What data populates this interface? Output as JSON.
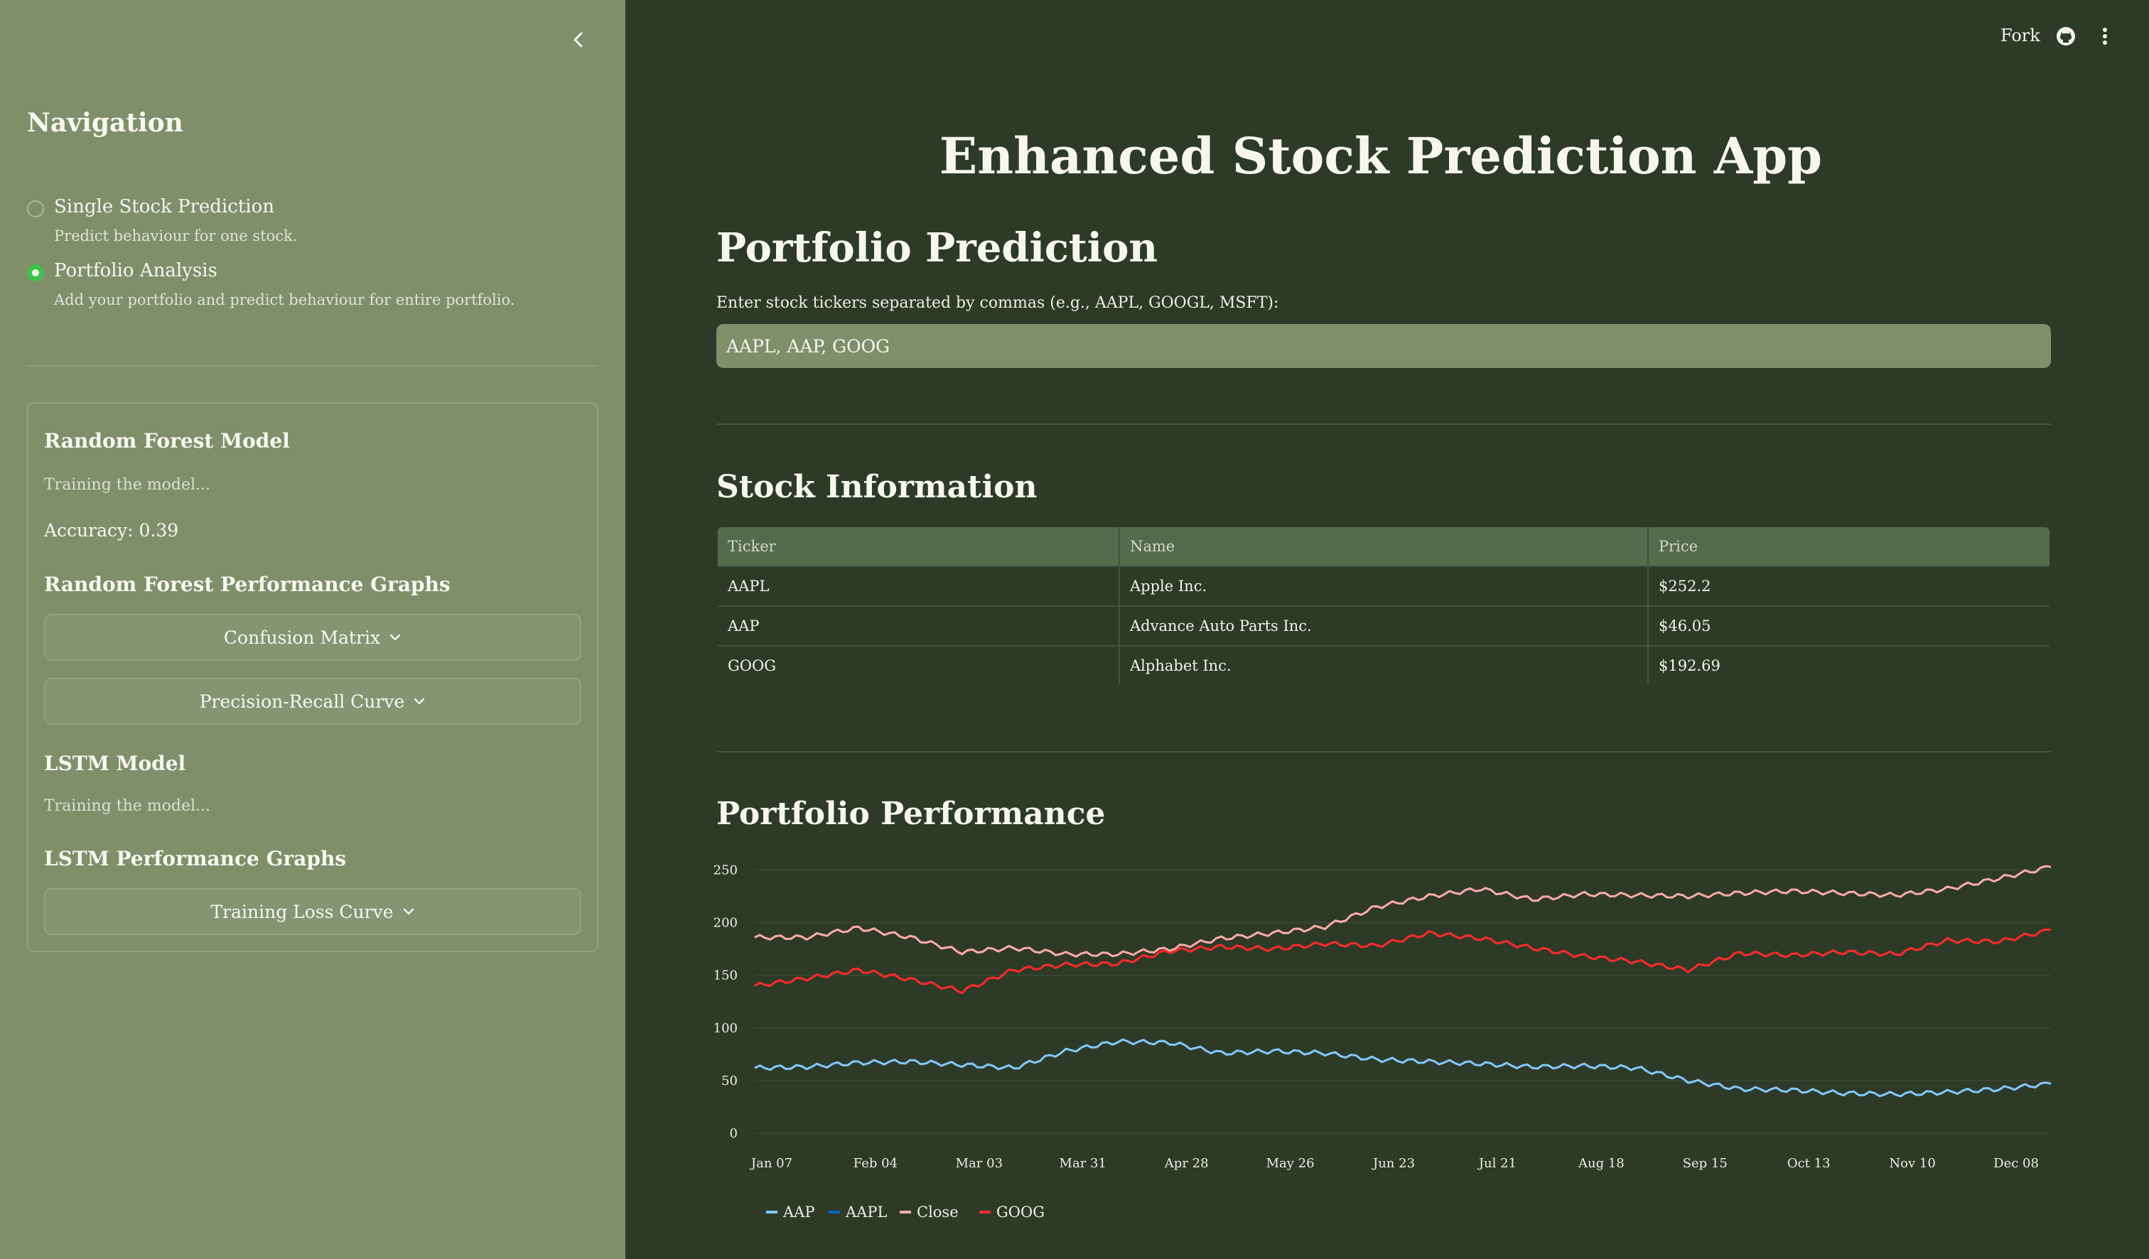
{
  "header": {
    "fork_label": "Fork",
    "icons": [
      "github-icon",
      "more-vertical-icon"
    ]
  },
  "sidebar": {
    "collapse_icon": "chevron-left-icon",
    "nav_title": "Navigation",
    "options": [
      {
        "label": "Single Stock Prediction",
        "caption": "Predict behaviour for one stock.",
        "selected": false
      },
      {
        "label": "Portfolio Analysis",
        "caption": "Add your portfolio and predict behaviour for entire portfolio.",
        "selected": true
      }
    ],
    "rf_title": "Random Forest Model",
    "rf_status": "Training the model...",
    "rf_accuracy": "Accuracy: 0.39",
    "rf_graphs_title": "Random Forest Performance Graphs",
    "confusion_label": "Confusion Matrix",
    "pr_label": "Precision-Recall Curve",
    "lstm_title": "LSTM Model",
    "lstm_status": "Training the model...",
    "lstm_graphs_title": "LSTM Performance Graphs",
    "loss_label": "Training Loss Curve"
  },
  "main": {
    "app_title": "Enhanced Stock Prediction App",
    "portfolio_title": "Portfolio Prediction",
    "ticker_label": "Enter stock tickers separated by commas (e.g., AAPL, GOOGL, MSFT):",
    "ticker_value": "AAPL, AAP, GOOG",
    "stock_info_title": "Stock Information",
    "table": {
      "columns": [
        "Ticker",
        "Name",
        "Price"
      ],
      "rows": [
        [
          "AAPL",
          "Apple Inc.",
          "$252.2"
        ],
        [
          "AAP",
          "Advance Auto Parts Inc.",
          "$46.05"
        ],
        [
          "GOOG",
          "Alphabet Inc.",
          "$192.69"
        ]
      ]
    },
    "performance_title": "Portfolio Performance"
  },
  "colors": {
    "sidebar_bg": "#7f8f6a",
    "main_bg": "#2e3a28",
    "radio_selected": "#40c24a",
    "aap": "#83c9ff",
    "aapl": "#0068c9",
    "close": "#ffabab",
    "goog": "#ff2b2b"
  },
  "chart_data": {
    "type": "line",
    "x": [
      "Jan 07",
      "Jan 21",
      "Feb 04",
      "Feb 18",
      "Mar 03",
      "Mar 17",
      "Mar 31",
      "Apr 14",
      "Apr 28",
      "May 12",
      "May 26",
      "Jun 09",
      "Jun 23",
      "Jul 07",
      "Jul 21",
      "Aug 04",
      "Aug 18",
      "Sep 01",
      "Sep 15",
      "Sep 29",
      "Oct 13",
      "Oct 27",
      "Nov 10",
      "Nov 24",
      "Dec 08",
      "Dec 22"
    ],
    "x_ticks": [
      "Jan 07",
      "Feb 04",
      "Mar 03",
      "Mar 31",
      "Apr 28",
      "May 26",
      "Jun 23",
      "Jul 21",
      "Aug 18",
      "Sep 15",
      "Oct 13",
      "Nov 10",
      "Dec 08"
    ],
    "y_ticks": [
      0,
      50,
      100,
      150,
      200,
      250
    ],
    "ylim": [
      0,
      255
    ],
    "grid": true,
    "legend_position": "bottom-left",
    "series": [
      {
        "name": "AAP",
        "color": "#83c9ff",
        "values": [
          62,
          63,
          67,
          68,
          65,
          62,
          78,
          87,
          86,
          76,
          78,
          76,
          70,
          68,
          66,
          63,
          64,
          62,
          50,
          42,
          41,
          38,
          37,
          39,
          42,
          47
        ]
      },
      {
        "name": "AAPL",
        "color": "#0068c9",
        "values": []
      },
      {
        "name": "Close",
        "color": "#ffabab",
        "values": [
          186,
          186,
          195,
          186,
          172,
          176,
          170,
          170,
          175,
          185,
          190,
          196,
          215,
          225,
          232,
          222,
          227,
          226,
          225,
          228,
          230,
          228,
          226,
          232,
          242,
          253
        ]
      },
      {
        "name": "GOOG",
        "color": "#ff2b2b",
        "values": [
          140,
          147,
          155,
          146,
          135,
          155,
          160,
          161,
          173,
          177,
          175,
          180,
          178,
          190,
          185,
          176,
          168,
          163,
          155,
          171,
          169,
          172,
          170,
          183,
          182,
          193
        ]
      }
    ]
  }
}
